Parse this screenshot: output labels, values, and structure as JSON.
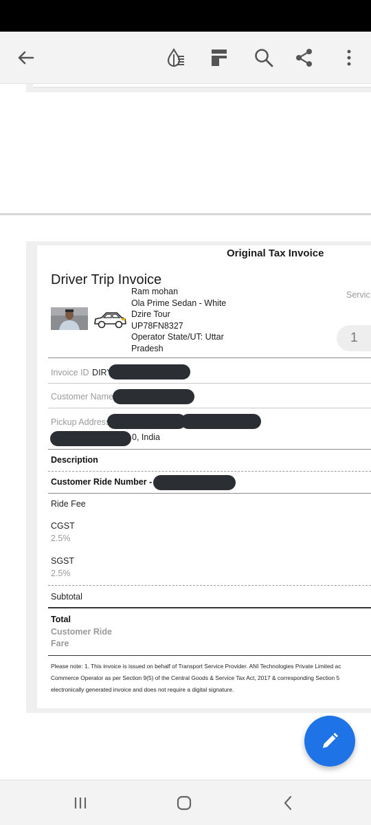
{
  "toolbar": {
    "icons": [
      "back-arrow-icon",
      "reading-mode-icon",
      "page-layout-icon",
      "search-icon",
      "share-icon",
      "more-options-icon"
    ]
  },
  "invoice": {
    "original_title": "Original Tax Invoice",
    "title": "Driver Trip Invoice",
    "driver_name": "Ram mohan",
    "vehicle_line1": "Ola Prime Sedan - White",
    "vehicle_line2": "Dzire Tour",
    "plate": "UP78FN8327",
    "operator_line1": "Operator State/UT: Uttar",
    "operator_line2": "Pradesh",
    "service_label": "Servic",
    "service_count": "1",
    "invoice_id_label": "Invoice ID",
    "invoice_id_value": "DIRY",
    "customer_name_label": "Customer Name",
    "pickup_label": "Pickup Address",
    "pickup_trail_char": ",",
    "pickup_line2_suffix": "0, India",
    "description_label": "Description",
    "ride_number_label": "Customer Ride Number -",
    "ride_fee_label": "Ride Fee",
    "cgst_label": "CGST",
    "cgst_rate": "2.5%",
    "sgst_label": "SGST",
    "sgst_rate": "2.5%",
    "subtotal_label": "Subtotal",
    "total_label": "Total",
    "total_sub_line1": "Customer Ride",
    "total_sub_line2": "Fare",
    "note_line1": "Please note: 1. This invoice is issued on behalf of Transport Service Provider. ANI Technologies Private Limited ac",
    "note_line2": "Commerce Operator as per Section 9(5) of the Central Goods & Service Tax Act, 2017 & corresponding Section 5",
    "note_line3": "electronically generated invoice and does not require a digital signature."
  },
  "fab": {
    "icon": "edit-pencil-icon"
  },
  "navbar": {
    "icons": [
      "recent-apps-icon",
      "home-icon",
      "back-icon"
    ]
  },
  "colors": {
    "fab": "#1e74e6",
    "redaction": "#2b2e33"
  }
}
